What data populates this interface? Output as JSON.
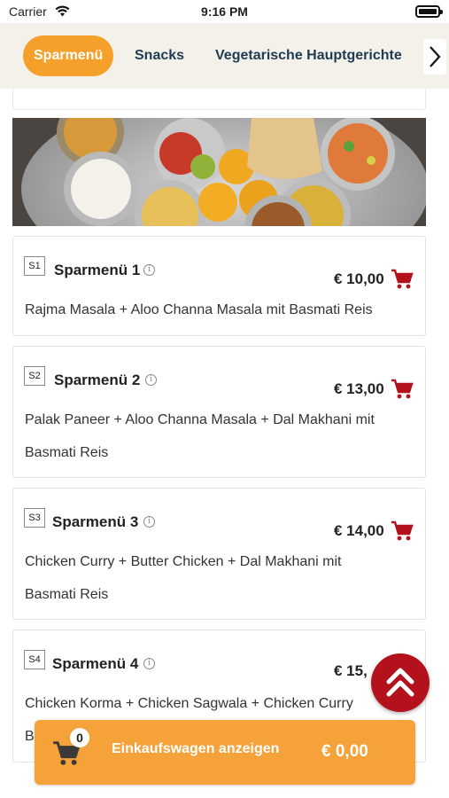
{
  "status_bar": {
    "carrier": "Carrier",
    "time": "9:16 PM"
  },
  "tabs": [
    {
      "label": "Sparmenü",
      "active": true
    },
    {
      "label": "Snacks",
      "active": false
    },
    {
      "label": "Vegetarische Hauptgerichte",
      "active": false
    }
  ],
  "tab_next_icon": "chevron-right-icon",
  "menu_items": [
    {
      "code": "S1",
      "name": "Sparmenü 1",
      "price": "€ 10,00",
      "description_lines": [
        "Rajma Masala + Aloo Channa Masala mit Basmati Reis"
      ]
    },
    {
      "code": "S2",
      "name": "Sparmenü 2",
      "price": "€ 13,00",
      "description_lines": [
        "Palak Paneer + Aloo Channa Masala + Dal Makhani mit",
        "Basmati Reis"
      ]
    },
    {
      "code": "S3",
      "name": "Sparmenü 3",
      "price": "€ 14,00",
      "description_lines": [
        "Chicken Curry + Butter Chicken + Dal Makhani mit",
        "Basmati Reis"
      ]
    },
    {
      "code": "S4",
      "name": "Sparmenü 4",
      "price": "€ 15,",
      "description_lines": [
        "Chicken Korma + Chicken Sagwala + Chicken Curry",
        "B"
      ]
    }
  ],
  "cart_bar": {
    "count": "0",
    "label": "Einkaufswagen anzeigen",
    "total": "€ 0,00"
  },
  "colors": {
    "accent": "#f5a23a",
    "cart_icon": "#b3121c",
    "fab": "#b3121c"
  }
}
